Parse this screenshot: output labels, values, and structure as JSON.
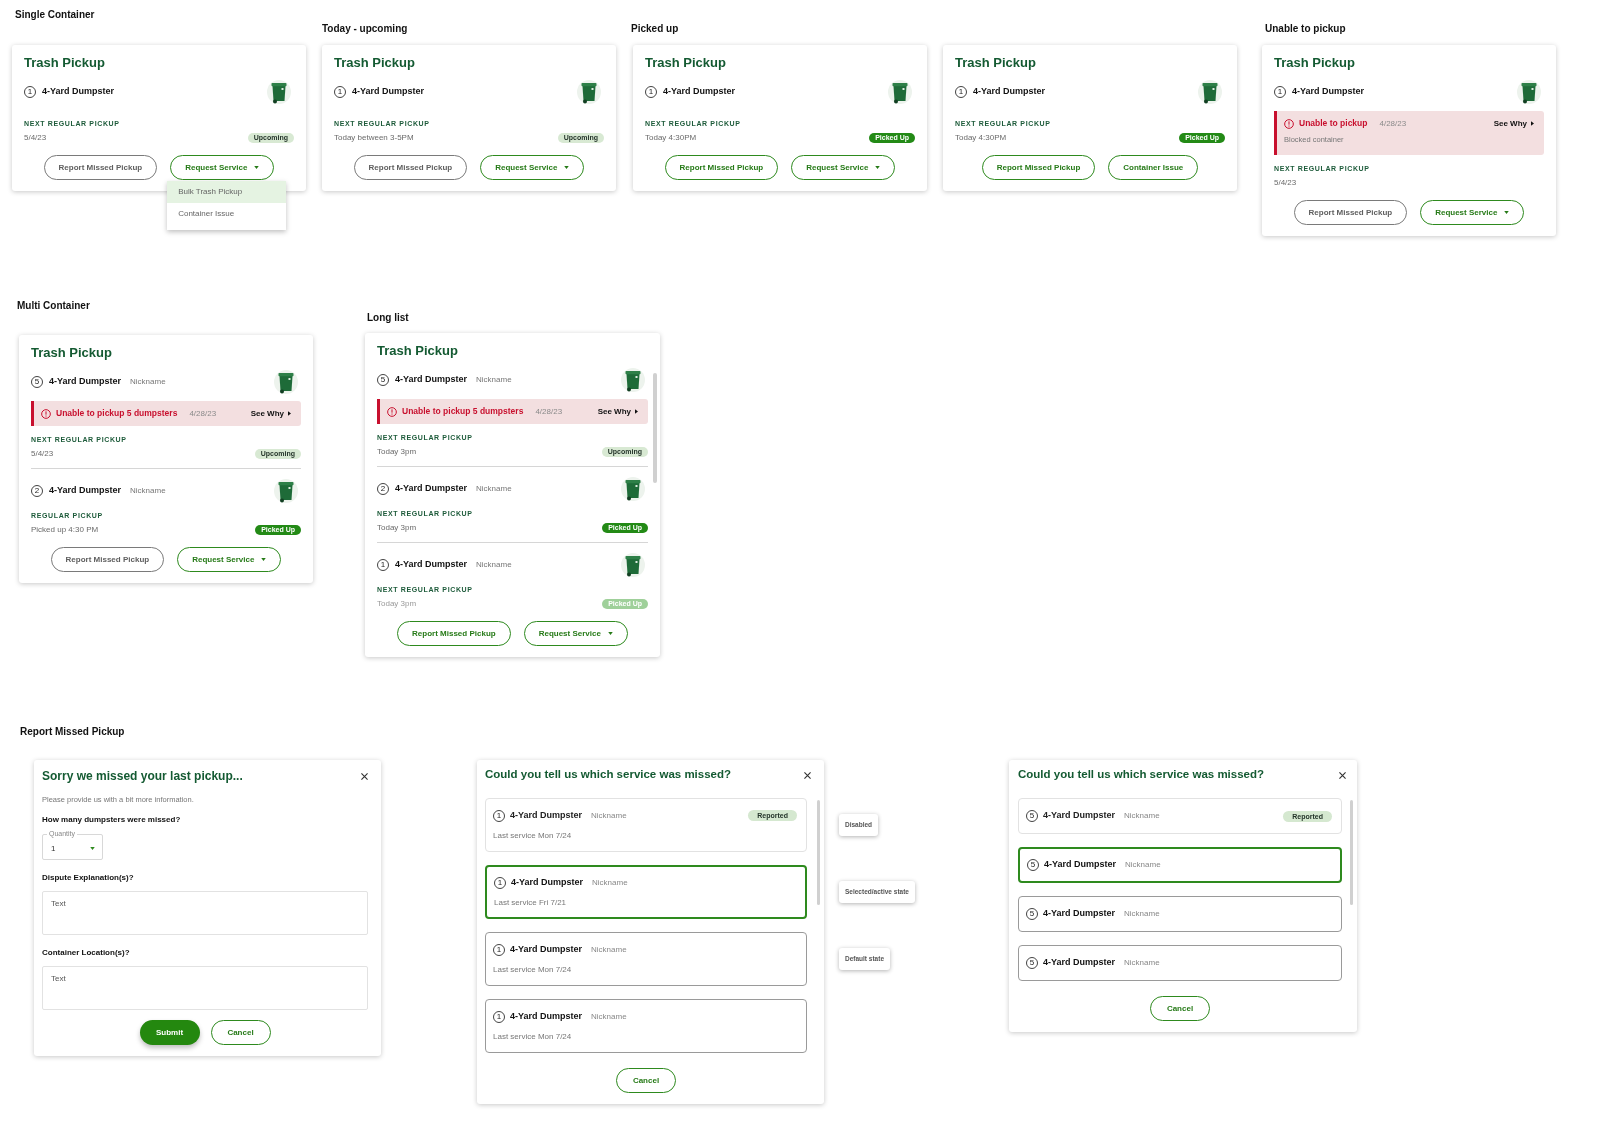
{
  "cards": [
    {
      "heading": "Single Container",
      "title": "Trash Pickup",
      "containers": [
        {
          "count": "1",
          "name": "4-Yard Dumpster",
          "pickup_label": "NEXT REGULAR PICKUP",
          "pickup_value": "5/4/23",
          "status": {
            "label": "Upcoming",
            "kind": "upcoming"
          },
          "faded": false
        }
      ],
      "buttons": [
        {
          "label": "Report Missed Pickup",
          "kind": "neutral",
          "caret": false
        },
        {
          "label": "Request Service",
          "kind": "outline",
          "caret": true,
          "menu": [
            {
              "label": "Bulk Trash Pickup",
              "selected": true
            },
            {
              "label": "Container Issue",
              "selected": false
            }
          ]
        }
      ]
    },
    {
      "heading": "Today - upcoming",
      "title": "Trash Pickup",
      "containers": [
        {
          "count": "1",
          "name": "4-Yard Dumpster",
          "pickup_label": "NEXT REGULAR PICKUP",
          "pickup_value": "Today between 3-5PM",
          "status": {
            "label": "Upcoming",
            "kind": "upcoming"
          },
          "faded": false
        }
      ],
      "buttons": [
        {
          "label": "Report Missed Pickup",
          "kind": "neutral",
          "caret": false
        },
        {
          "label": "Request Service",
          "kind": "outline",
          "caret": true
        }
      ]
    },
    {
      "heading": "Picked up",
      "title": "Trash Pickup",
      "containers": [
        {
          "count": "1",
          "name": "4-Yard Dumpster",
          "pickup_label": "NEXT REGULAR PICKUP",
          "pickup_value": "Today 4:30PM",
          "status": {
            "label": "Picked Up",
            "kind": "picked_up"
          },
          "faded": false
        }
      ],
      "buttons": [
        {
          "label": "Report Missed Pickup",
          "kind": "outline",
          "caret": false
        },
        {
          "label": "Request Service",
          "kind": "outline",
          "caret": true
        }
      ]
    },
    {
      "title": "Trash Pickup",
      "containers": [
        {
          "count": "1",
          "name": "4-Yard Dumpster",
          "pickup_label": "NEXT REGULAR PICKUP",
          "pickup_value": "Today 4:30PM",
          "status": {
            "label": "Picked Up",
            "kind": "picked_up"
          },
          "faded": false
        }
      ],
      "buttons": [
        {
          "label": "Report Missed Pickup",
          "kind": "outline",
          "caret": false
        },
        {
          "label": "Container Issue",
          "kind": "outline",
          "caret": false
        }
      ]
    },
    {
      "heading": "Unable to pickup",
      "title": "Trash Pickup",
      "containers": [
        {
          "count": "1",
          "name": "4-Yard Dumpster",
          "alert": {
            "title": "Unable to pickup",
            "date": "4/28/23",
            "link": "See Why",
            "detail": "Blocked container"
          },
          "pickup_label": "NEXT REGULAR PICKUP",
          "pickup_value": "5/4/23",
          "faded": false
        }
      ],
      "buttons": [
        {
          "label": "Report Missed Pickup",
          "kind": "neutral",
          "caret": false
        },
        {
          "label": "Request Service",
          "kind": "outline",
          "caret": true
        }
      ]
    },
    {
      "heading": "Multi Container",
      "title": "Trash Pickup",
      "containers": [
        {
          "count": "5",
          "name": "4-Yard Dumpster",
          "nickname": "Nickname",
          "alert": {
            "title": "Unable to pickup 5 dumpsters",
            "date": "4/28/23",
            "link": "See Why"
          },
          "pickup_label": "NEXT REGULAR PICKUP",
          "pickup_value": "5/4/23",
          "status": {
            "label": "Upcoming",
            "kind": "upcoming"
          },
          "faded": false
        },
        {
          "count": "2",
          "name": "4-Yard Dumpster",
          "nickname": "Nickname",
          "pickup_label": "REGULAR PICKUP",
          "pickup_value": "Picked up 4:30 PM",
          "status": {
            "label": "Picked Up",
            "kind": "picked_up"
          },
          "faded": false
        }
      ],
      "buttons": [
        {
          "label": "Report Missed Pickup",
          "kind": "neutral",
          "caret": false
        },
        {
          "label": "Request Service",
          "kind": "outline",
          "caret": true
        }
      ]
    },
    {
      "heading": "Long list",
      "title": "Trash Pickup",
      "scrollbar": true,
      "containers": [
        {
          "count": "5",
          "name": "4-Yard Dumpster",
          "nickname": "Nickname",
          "alert": {
            "title": "Unable to pickup 5 dumpsters",
            "date": "4/28/23",
            "link": "See Why"
          },
          "pickup_label": "NEXT REGULAR PICKUP",
          "pickup_value": "Today 3pm",
          "status": {
            "label": "Upcoming",
            "kind": "upcoming"
          },
          "faded": false
        },
        {
          "count": "2",
          "name": "4-Yard Dumpster",
          "nickname": "Nickname",
          "pickup_label": "NEXT REGULAR PICKUP",
          "pickup_value": "Today 3pm",
          "status": {
            "label": "Picked Up",
            "kind": "picked_up"
          },
          "faded": false
        },
        {
          "count": "1",
          "name": "4-Yard Dumpster",
          "nickname": "Nickname",
          "pickup_label": "NEXT REGULAR PICKUP",
          "pickup_value": "Today 3pm",
          "status": {
            "label": "Picked Up",
            "kind": "picked_up"
          },
          "faded": true
        }
      ],
      "buttons": [
        {
          "label": "Report Missed Pickup",
          "kind": "outline",
          "caret": false
        },
        {
          "label": "Request Service",
          "kind": "outline",
          "caret": true
        }
      ]
    }
  ],
  "report_form": {
    "heading": "Report Missed Pickup",
    "title": "Sorry we missed your last pickup...",
    "intro": "Please provide us with a bit more information.",
    "quantity": {
      "question": "How many dumpsters were missed?",
      "label": "Quantity",
      "value": "1"
    },
    "fields": [
      {
        "question": "Dispute Explanation(s)?",
        "placeholder": "Text"
      },
      {
        "question": "Container Location(s)?",
        "placeholder": "Text"
      }
    ],
    "buttons": [
      {
        "label": "Submit",
        "kind": "filled"
      },
      {
        "label": "Cancel",
        "kind": "outline"
      }
    ]
  },
  "service_pickers": [
    {
      "title": "Could you tell us which service was missed?",
      "scrollbar": true,
      "options": [
        {
          "count": "1",
          "name": "4-Yard Dumpster",
          "nickname": "Nickname",
          "last_service": "Last service Mon 7/24",
          "badge": "Reported",
          "disabled": true,
          "selected": false,
          "note": "Disabled"
        },
        {
          "count": "1",
          "name": "4-Yard Dumpster",
          "nickname": "Nickname",
          "last_service": "Last service Fri 7/21",
          "disabled": false,
          "selected": true,
          "note": "Selected/active state"
        },
        {
          "count": "1",
          "name": "4-Yard Dumpster",
          "nickname": "Nickname",
          "last_service": "Last service Mon 7/24",
          "disabled": false,
          "selected": false,
          "note": "Default state"
        },
        {
          "count": "1",
          "name": "4-Yard Dumpster",
          "nickname": "Nickname",
          "last_service": "Last service Mon 7/24",
          "disabled": false,
          "selected": false
        }
      ],
      "buttons": [
        {
          "label": "Cancel",
          "kind": "outline"
        }
      ]
    },
    {
      "title": "Could you tell us which service was missed?",
      "scrollbar": true,
      "options": [
        {
          "count": "5",
          "name": "4-Yard Dumpster",
          "nickname": "Nickname",
          "badge": "Reported",
          "disabled": true,
          "selected": false
        },
        {
          "count": "5",
          "name": "4-Yard Dumpster",
          "nickname": "Nickname",
          "disabled": false,
          "selected": true
        },
        {
          "count": "5",
          "name": "4-Yard Dumpster",
          "nickname": "Nickname",
          "disabled": false,
          "selected": false
        },
        {
          "count": "5",
          "name": "4-Yard Dumpster",
          "nickname": "Nickname",
          "disabled": false,
          "selected": false
        }
      ],
      "buttons": [
        {
          "label": "Cancel",
          "kind": "outline"
        }
      ]
    }
  ]
}
